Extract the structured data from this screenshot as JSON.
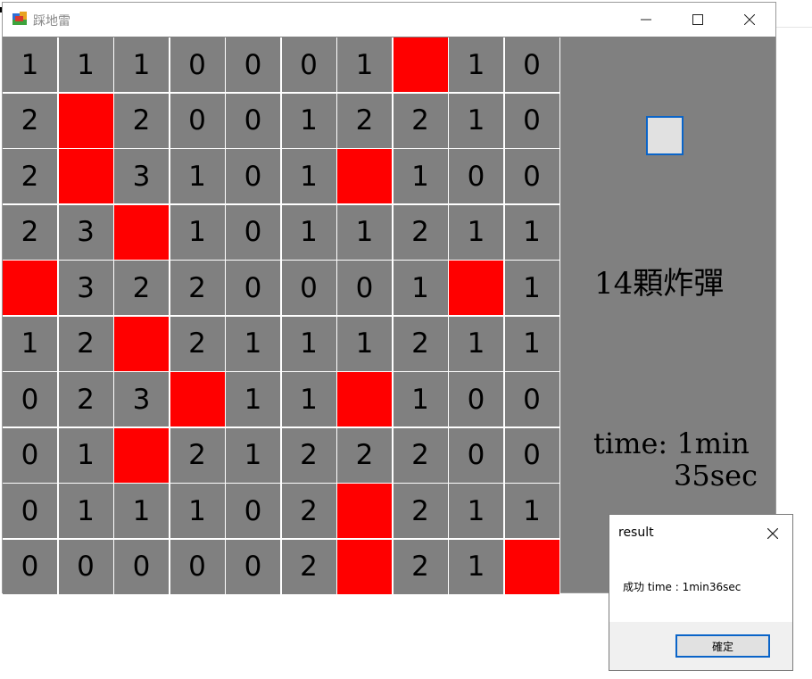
{
  "window": {
    "title": "踩地雷",
    "controls": {
      "minimize": "minimize-icon",
      "maximize": "maximize-icon",
      "close": "close-icon"
    }
  },
  "board": {
    "mine_color": "#ff0000",
    "cell_color": "#808080",
    "rows": [
      [
        "1",
        "1",
        "1",
        "0",
        "0",
        "0",
        "1",
        "*",
        "1",
        "0"
      ],
      [
        "2",
        "*",
        "2",
        "0",
        "0",
        "1",
        "2",
        "2",
        "1",
        "0"
      ],
      [
        "2",
        "*",
        "3",
        "1",
        "0",
        "1",
        "*",
        "1",
        "0",
        "0"
      ],
      [
        "2",
        "3",
        "*",
        "1",
        "0",
        "1",
        "1",
        "2",
        "1",
        "1"
      ],
      [
        "*",
        "3",
        "2",
        "2",
        "0",
        "0",
        "0",
        "1",
        "*",
        "1"
      ],
      [
        "1",
        "2",
        "*",
        "2",
        "1",
        "1",
        "1",
        "2",
        "1",
        "1"
      ],
      [
        "0",
        "2",
        "3",
        "*",
        "1",
        "1",
        "*",
        "1",
        "0",
        "0"
      ],
      [
        "0",
        "1",
        "*",
        "2",
        "1",
        "2",
        "2",
        "2",
        "0",
        "0"
      ],
      [
        "0",
        "1",
        "1",
        "1",
        "0",
        "2",
        "*",
        "2",
        "1",
        "1"
      ],
      [
        "0",
        "0",
        "0",
        "0",
        "0",
        "2",
        "*",
        "2",
        "1",
        "*"
      ]
    ]
  },
  "panel": {
    "bomb_count": "14顆炸彈",
    "time_label": "time: 1min",
    "time_sec": "35sec"
  },
  "dialog": {
    "title": "result",
    "message": "成功  time : 1min36sec",
    "ok_label": "確定"
  },
  "colors": {
    "accent": "#0a64c8",
    "panel_bg": "#808080"
  }
}
